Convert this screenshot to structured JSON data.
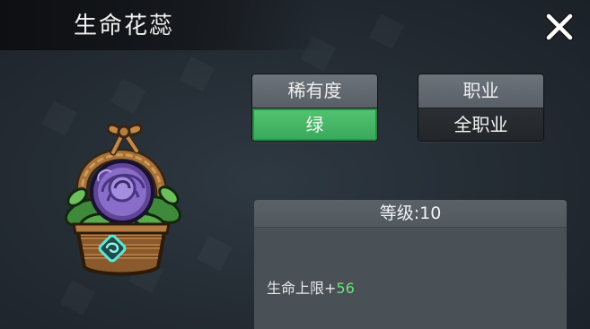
{
  "dialog": {
    "title": "生命花蕊",
    "close_icon": "close-icon"
  },
  "item": {
    "icon": "flower-basket-icon"
  },
  "rarity": {
    "label": "稀有度",
    "value": "绿",
    "color": "#45b864"
  },
  "profession": {
    "label": "职业",
    "value": "全职业"
  },
  "info": {
    "level_text": "等级:10",
    "attribute_name": "生命上限",
    "attribute_sign": "+",
    "attribute_value": "56",
    "attribute_value_color": "#6be07a"
  }
}
